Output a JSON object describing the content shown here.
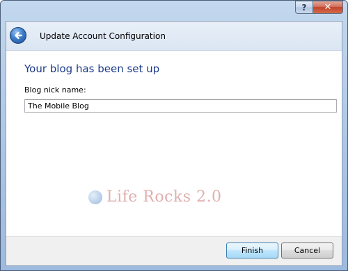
{
  "window": {
    "help_label": "?",
    "close_label": "✕"
  },
  "header": {
    "title": "Update Account Configuration",
    "back_icon": "back-arrow-icon"
  },
  "main": {
    "heading": "Your blog has been set up",
    "nickname_label": "Blog nick name:",
    "nickname_value": "The Mobile Blog"
  },
  "watermark": {
    "text": "Life Rocks 2.0"
  },
  "footer": {
    "finish_label": "Finish",
    "cancel_label": "Cancel"
  },
  "colors": {
    "heading": "#1c3b8a",
    "frame": "#a9c4e4",
    "close_button": "#c2432c"
  }
}
